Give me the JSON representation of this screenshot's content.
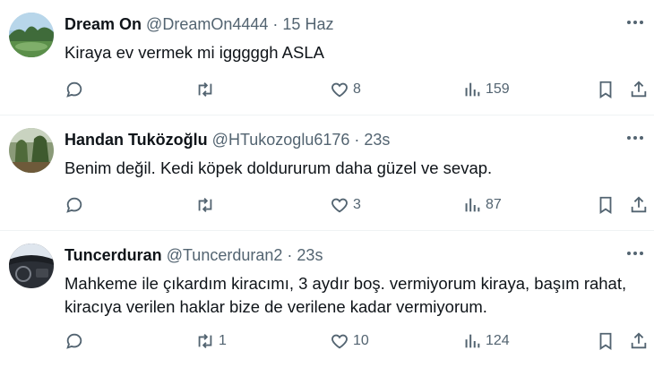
{
  "tweets": [
    {
      "name": "Dream On",
      "handle": "@DreamOn4444",
      "separator": "·",
      "time": "15 Haz",
      "text": "Kiraya ev vermek mi igggggh ASLA",
      "replies": "",
      "retweets": "",
      "likes": "8",
      "views": "159",
      "avatar_icon": "landscape-photo"
    },
    {
      "name": "Handan Tuközoğlu",
      "handle": "@HTukozoglu6176",
      "separator": "·",
      "time": "23s",
      "text": "Benim değil. Kedi köpek doldururum daha güzel ve sevap.",
      "replies": "",
      "retweets": "",
      "likes": "3",
      "views": "87",
      "avatar_icon": "garden-photo"
    },
    {
      "name": "Tuncerduran",
      "handle": "@Tuncerduran2",
      "separator": "·",
      "time": "23s",
      "text": "Mahkeme ile çıkardım kiracımı, 3 aydır boş. vermiyorum kiraya, başım rahat, kiracıya verilen haklar bize de verilene kadar vermiyorum.",
      "replies": "",
      "retweets": "1",
      "likes": "10",
      "views": "124",
      "avatar_icon": "car-interior-photo"
    }
  ],
  "colors": {
    "text": "#0f1419",
    "secondary": "#536471",
    "divider": "#eff3f4"
  }
}
